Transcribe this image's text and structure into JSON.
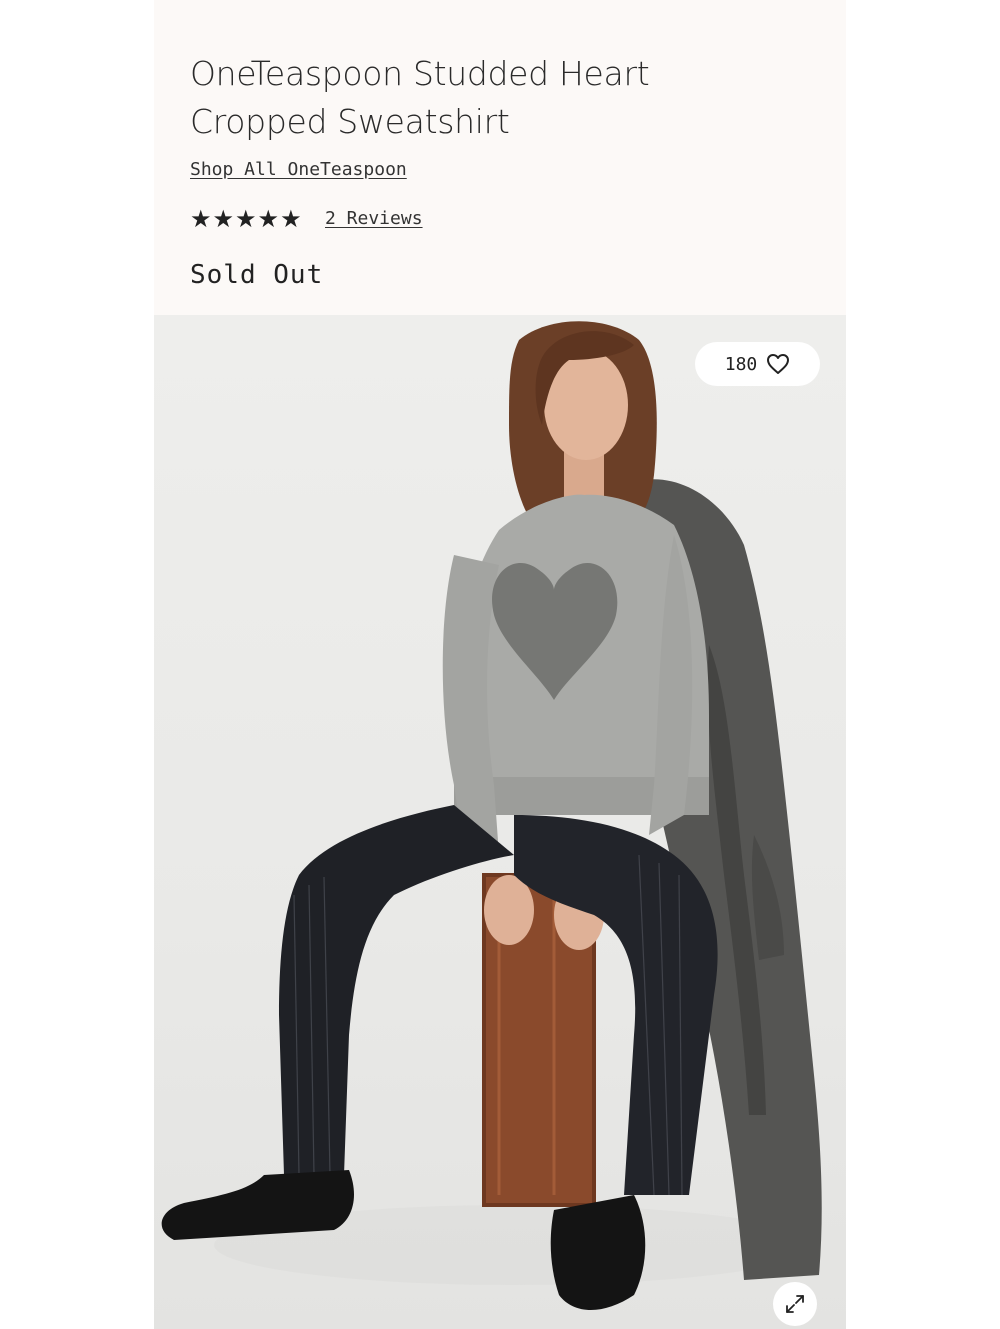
{
  "product": {
    "title_line1": "OneTeaspoon Studded Heart",
    "title_line2": "Cropped Sweatshirt",
    "brand_link": "Shop All OneTeaspoon",
    "rating_stars": [
      "★",
      "★",
      "★",
      "★",
      "★"
    ],
    "rating": 5,
    "reviews_link": "2 Reviews",
    "availability": "Sold Out"
  },
  "image": {
    "like_count": "180",
    "like_icon": "heart-outline-icon",
    "expand_icon": "expand-arrows-icon"
  },
  "colors": {
    "panel_background": "#fcf9f7",
    "text": "#262626",
    "image_background": "#eeeeec"
  }
}
